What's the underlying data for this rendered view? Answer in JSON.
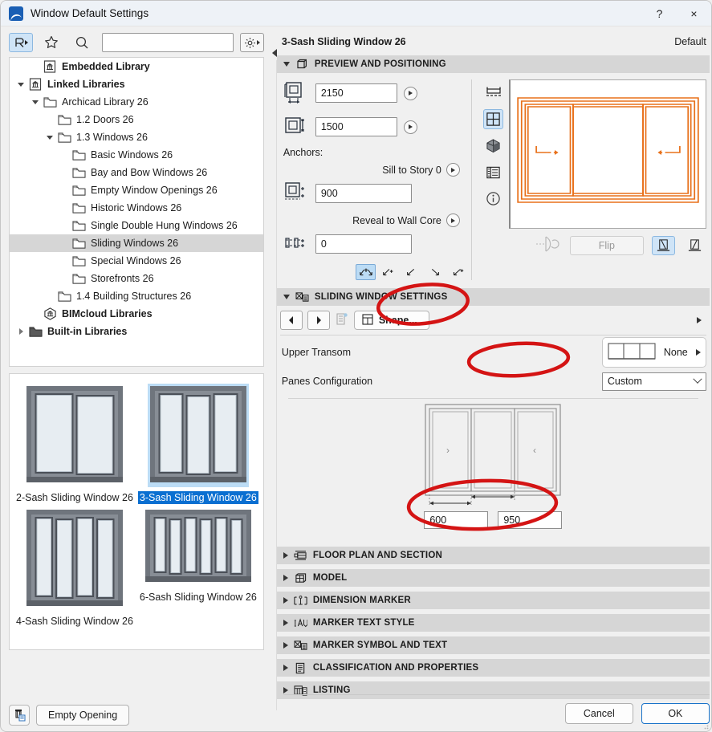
{
  "window": {
    "title": "Window Default Settings",
    "help_label": "?",
    "close_label": "×"
  },
  "toolbar": {
    "object_icon": "chair-object-icon",
    "favorite_icon": "star-icon",
    "search_icon": "search-icon",
    "search_value": "",
    "search_placeholder": "",
    "settings_icon": "gear-icon"
  },
  "tree": {
    "items": [
      {
        "label": "Embedded Library",
        "indent": 1,
        "twisty": "none",
        "icon": "library-icon",
        "bold": true,
        "selected": false
      },
      {
        "label": "Linked Libraries",
        "indent": 0,
        "twisty": "down",
        "icon": "library-icon",
        "bold": true,
        "selected": false
      },
      {
        "label": "Archicad Library 26",
        "indent": 1,
        "twisty": "down",
        "icon": "folder-icon",
        "bold": false,
        "selected": false
      },
      {
        "label": "1.2 Doors 26",
        "indent": 2,
        "twisty": "none",
        "icon": "folder-icon",
        "bold": false,
        "selected": false
      },
      {
        "label": "1.3 Windows 26",
        "indent": 2,
        "twisty": "down",
        "icon": "folder-icon",
        "bold": false,
        "selected": false
      },
      {
        "label": "Basic Windows 26",
        "indent": 3,
        "twisty": "none",
        "icon": "folder-icon",
        "bold": false,
        "selected": false
      },
      {
        "label": "Bay and Bow Windows 26",
        "indent": 3,
        "twisty": "none",
        "icon": "folder-icon",
        "bold": false,
        "selected": false
      },
      {
        "label": "Empty Window Openings 26",
        "indent": 3,
        "twisty": "none",
        "icon": "folder-icon",
        "bold": false,
        "selected": false
      },
      {
        "label": "Historic Windows 26",
        "indent": 3,
        "twisty": "none",
        "icon": "folder-icon",
        "bold": false,
        "selected": false
      },
      {
        "label": "Single Double Hung Windows 26",
        "indent": 3,
        "twisty": "none",
        "icon": "folder-icon",
        "bold": false,
        "selected": false
      },
      {
        "label": "Sliding Windows 26",
        "indent": 3,
        "twisty": "none",
        "icon": "folder-icon",
        "bold": false,
        "selected": true
      },
      {
        "label": "Special Windows 26",
        "indent": 3,
        "twisty": "none",
        "icon": "folder-icon",
        "bold": false,
        "selected": false
      },
      {
        "label": "Storefronts 26",
        "indent": 3,
        "twisty": "none",
        "icon": "folder-icon",
        "bold": false,
        "selected": false
      },
      {
        "label": "1.4 Building Structures 26",
        "indent": 2,
        "twisty": "none",
        "icon": "folder-icon",
        "bold": false,
        "selected": false
      },
      {
        "label": "BIMcloud Libraries",
        "indent": 1,
        "twisty": "none",
        "icon": "bimcloud-icon",
        "bold": true,
        "selected": false
      },
      {
        "label": "Built-in Libraries",
        "indent": 0,
        "twisty": "right",
        "icon": "folder-filled-icon",
        "bold": true,
        "selected": false
      }
    ]
  },
  "thumbnails": [
    {
      "label": "2-Sash Sliding Window 26",
      "panes": 2,
      "selected": false,
      "aspect": "tall"
    },
    {
      "label": "3-Sash Sliding Window 26",
      "panes": 3,
      "selected": true,
      "aspect": "tall"
    },
    {
      "label": "4-Sash Sliding Window 26",
      "panes": 4,
      "selected": false,
      "aspect": "tall"
    },
    {
      "label": "6-Sash Sliding Window 26",
      "panes": 6,
      "selected": false,
      "aspect": "wide"
    }
  ],
  "footer_left": {
    "object_icon": "object-settings-icon",
    "empty_opening_label": "Empty Opening"
  },
  "detail": {
    "title": "3-Sash Sliding Window 26",
    "default_label": "Default",
    "sections": {
      "preview_positioning": {
        "label": "PREVIEW AND POSITIONING",
        "expanded": true,
        "icon": "cube-preview-icon",
        "width_value": "2150",
        "width_icon": "window-width-icon",
        "height_value": "1500",
        "height_icon": "window-height-icon",
        "anchors_label": "Anchors:",
        "sill_label": "Sill to Story 0",
        "sill_value": "900",
        "sill_icon": "sill-anchor-icon",
        "reveal_label": "Reveal to Wall Core",
        "reveal_value": "0",
        "reveal_icon": "reveal-anchor-icon",
        "anchor_toggles": [
          {
            "name": "anchor-center",
            "selected": true
          },
          {
            "name": "anchor-corner-1",
            "selected": false
          },
          {
            "name": "anchor-corner-2",
            "selected": false
          },
          {
            "name": "anchor-corner-3",
            "selected": false
          },
          {
            "name": "anchor-corner-4",
            "selected": false
          }
        ],
        "view_modes": [
          {
            "name": "section-view-icon",
            "selected": false
          },
          {
            "name": "elevation-view-icon",
            "selected": true
          },
          {
            "name": "3d-view-icon",
            "selected": false
          },
          {
            "name": "list-view-icon",
            "selected": false
          },
          {
            "name": "info-view-icon",
            "selected": false
          }
        ],
        "flip_label": "Flip",
        "flip_enabled": false,
        "mirror_buttons": [
          {
            "name": "mirror-left-icon",
            "selected": true
          },
          {
            "name": "mirror-right-icon",
            "selected": false
          }
        ],
        "preview_accent_color": "#e8701a"
      },
      "sliding_window_settings": {
        "label": "SLIDING WINDOW SETTINGS",
        "expanded": true,
        "icon": "marker-symbol-icon",
        "nav_prev_icon": "arrow-left-icon",
        "nav_next_icon": "arrow-right-icon",
        "list_icon": "page-list-icon",
        "shape_label": "Shape...",
        "shape_icon": "grid-shape-icon",
        "upper_transom_label": "Upper Transom",
        "upper_transom_value": "None",
        "panes_config_label": "Panes Configuration",
        "panes_config_value": "Custom",
        "pane_count": 3,
        "pane_arrows": [
          "right",
          "none",
          "left"
        ],
        "dim_values": [
          "600",
          "950"
        ]
      }
    },
    "collapsed_sections": [
      {
        "label": "FLOOR PLAN AND SECTION",
        "icon": "floor-plan-icon"
      },
      {
        "label": "MODEL",
        "icon": "model-icon"
      },
      {
        "label": "DIMENSION MARKER",
        "icon": "dimension-marker-icon"
      },
      {
        "label": "MARKER TEXT STYLE",
        "icon": "marker-text-style-icon"
      },
      {
        "label": "MARKER SYMBOL AND TEXT",
        "icon": "marker-symbol-icon"
      },
      {
        "label": "CLASSIFICATION AND PROPERTIES",
        "icon": "classification-icon"
      },
      {
        "label": "LISTING",
        "icon": "listing-icon"
      }
    ],
    "buttons": {
      "cancel": "Cancel",
      "ok": "OK"
    }
  },
  "annotations": {
    "color": "#d41414",
    "marks": [
      "shape-button-ellipse",
      "panes-config-ellipse",
      "dimensions-ellipse"
    ]
  }
}
